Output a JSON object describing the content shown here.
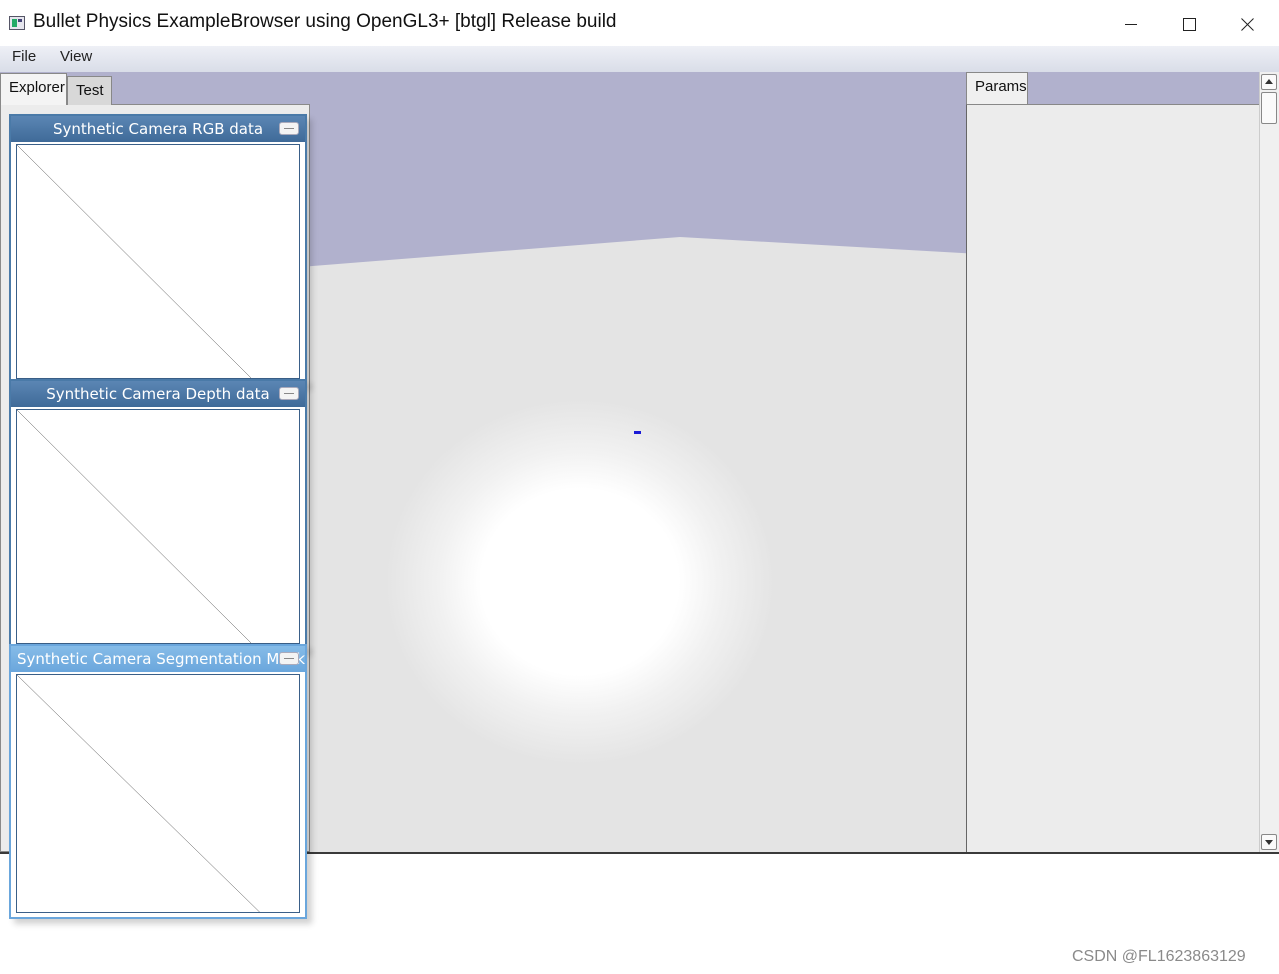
{
  "window": {
    "title": "Bullet Physics ExampleBrowser using OpenGL3+ [btgl] Release build"
  },
  "menubar": {
    "items": [
      {
        "label": "File"
      },
      {
        "label": "View"
      }
    ]
  },
  "explorer": {
    "tabs": [
      {
        "label": "Explorer",
        "active": true
      },
      {
        "label": "Test",
        "active": false
      }
    ]
  },
  "params": {
    "tabs": [
      {
        "label": "Params",
        "active": true
      }
    ]
  },
  "camera_windows": [
    {
      "title": "Synthetic Camera RGB data"
    },
    {
      "title": "Synthetic Camera Depth data"
    },
    {
      "title": "Synthetic Camera Segmentation Mask"
    }
  ],
  "colors": {
    "sky": "#b1b1cd",
    "ground": "#e4e4e4",
    "camera_header": "#4a7aa8",
    "camera_header_active": "#6aa6dc",
    "marker": "#1a1ad6"
  },
  "watermark": "CSDN @FL1623863129"
}
